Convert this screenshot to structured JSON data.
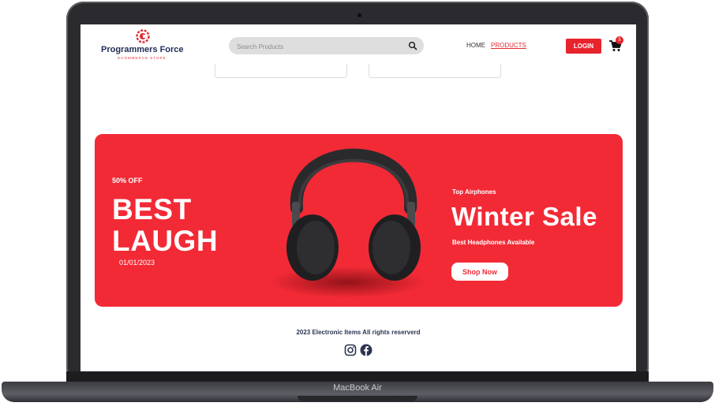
{
  "device": {
    "label": "MacBook Air"
  },
  "header": {
    "logo_name": "Programmers Force",
    "logo_tagline": "ECOMMERCE STORE",
    "search_placeholder": "Search Products",
    "nav": {
      "home": "HOME",
      "products": "PRODUCTS"
    },
    "login_label": "LOGIN",
    "cart_count": "5"
  },
  "banner": {
    "discount": "50% OFF",
    "headline_line1": "BEST",
    "headline_line2": "LAUGH",
    "date": "01/01/2023",
    "category": "Top Airphones",
    "title": "Winter Sale",
    "subtitle": "Best Headphones Available",
    "cta_label": "Shop Now"
  },
  "footer": {
    "copyright": "2023 Electronic Items All rights reserverd",
    "social_icons": [
      "instagram-icon",
      "facebook-icon"
    ]
  },
  "colors": {
    "accent": "#f22a36",
    "brand_navy": "#222d5a"
  }
}
